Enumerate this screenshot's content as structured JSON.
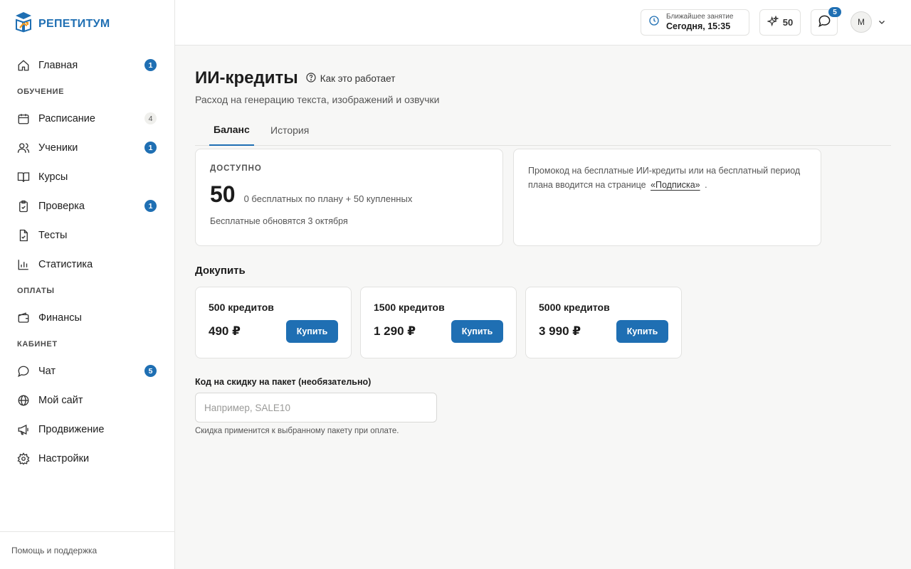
{
  "brand": {
    "name": "РЕПЕТИТУМ",
    "color": "#1f6fb3"
  },
  "sidebar": {
    "items": [
      {
        "label": "Главная",
        "icon": "home-icon",
        "badge": "1"
      },
      {
        "section": "ОБУЧЕНИЕ"
      },
      {
        "label": "Расписание",
        "icon": "calendar-icon",
        "badge": "4"
      },
      {
        "label": "Ученики",
        "icon": "users-icon",
        "badge": "1"
      },
      {
        "label": "Курсы",
        "icon": "book-icon"
      },
      {
        "label": "Проверка",
        "icon": "clipboard-check-icon",
        "badge": "1"
      },
      {
        "label": "Тесты",
        "icon": "file-check-icon"
      },
      {
        "label": "Статистика",
        "icon": "bar-chart-icon"
      },
      {
        "section": "ОПЛАТЫ"
      },
      {
        "label": "Финансы",
        "icon": "wallet-icon"
      },
      {
        "section": "КАБИНЕТ"
      },
      {
        "label": "Чат",
        "icon": "message-icon",
        "badge": "5"
      },
      {
        "label": "Мой сайт",
        "icon": "globe-icon"
      },
      {
        "label": "Продвижение",
        "icon": "megaphone-icon"
      },
      {
        "label": "Настройки",
        "icon": "gear-icon"
      }
    ],
    "help": "Помощь и поддержка"
  },
  "header": {
    "next_lesson_label": "Ближайшее занятие",
    "next_lesson_value": "Сегодня, 15:35",
    "credits": "50",
    "chat_badge": "5",
    "avatar_initial": "М"
  },
  "main": {
    "title": "ИИ-кредиты",
    "how_link": "Как это работает",
    "subtitle": "Расход на генерацию текста, изображений и озвучки",
    "tabs": [
      {
        "label": "Баланс",
        "active": true
      },
      {
        "label": "История",
        "active": false
      }
    ],
    "balance": {
      "label": "ДОСТУПНО",
      "value": "50",
      "desc": "0 бесплатных по плану + 50 купленных",
      "note": "Бесплатные обновятся 3 октября"
    },
    "promo": {
      "text_before": "Промокод на бесплатные ИИ-кредиты или на бесплатный период плана вводится на странице",
      "link": "«Подписка»",
      "text_after": "."
    },
    "buy_title": "Докупить",
    "packages": [
      {
        "name": "500 кредитов",
        "price": "490 ₽",
        "button": "Купить"
      },
      {
        "name": "1500 кредитов",
        "price": "1 290 ₽",
        "button": "Купить"
      },
      {
        "name": "5000 кредитов",
        "price": "3 990 ₽",
        "button": "Купить"
      }
    ],
    "discount": {
      "label": "Код на скидку на пакет (необязательно)",
      "placeholder": "Например, SALE10",
      "value": "",
      "hint": "Скидка применится к выбранному пакету при оплате."
    }
  }
}
